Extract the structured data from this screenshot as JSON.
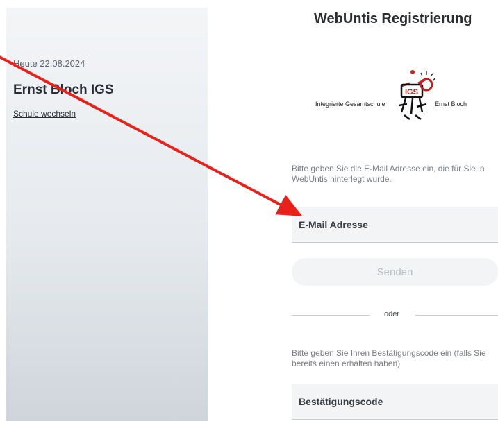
{
  "sidebar": {
    "date": "Heute 22.08.2024",
    "school_name": "Ernst Bloch IGS",
    "switch_school": "Schule wechseln"
  },
  "main": {
    "title": "WebUntis Registrierung",
    "logo": {
      "left_text": "Integrierte Gesamtschule",
      "right_text": "Ernst Bloch",
      "mark_text": "IGS"
    },
    "email_hint": "Bitte geben Sie die E-Mail Adresse ein, die für Sie in WebUntis hinterlegt wurde.",
    "email_placeholder": "E-Mail Adresse",
    "send_label": "Senden",
    "divider_label": "oder",
    "code_hint": "Bitte geben Sie Ihren Bestätigungscode ein (falls Sie bereits einen erhalten haben)",
    "code_placeholder": "Bestätigungscode"
  },
  "annotation": {
    "arrow_color": "#e8211b"
  }
}
